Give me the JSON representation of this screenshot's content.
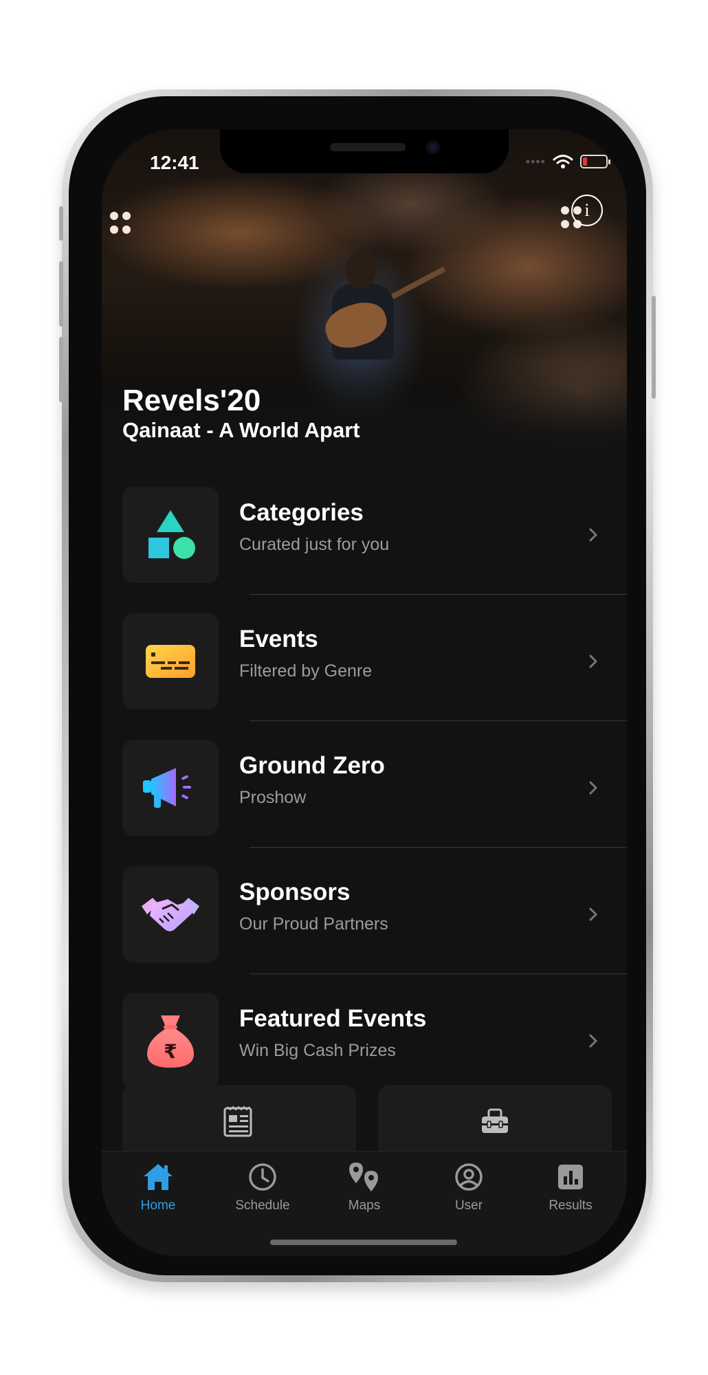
{
  "status_bar": {
    "time": "12:41"
  },
  "hero": {
    "title": "Revels'20",
    "subtitle": "Qainaat - A World Apart"
  },
  "menu": [
    {
      "title": "Categories",
      "subtitle": "Curated just for you",
      "icon": "shapes-icon"
    },
    {
      "title": "Events",
      "subtitle": "Filtered by Genre",
      "icon": "ticket-icon"
    },
    {
      "title": "Ground Zero",
      "subtitle": "Proshow",
      "icon": "megaphone-icon"
    },
    {
      "title": "Sponsors",
      "subtitle": "Our Proud Partners",
      "icon": "handshake-icon"
    },
    {
      "title": "Featured Events",
      "subtitle": "Win Big Cash Prizes",
      "icon": "money-bag-icon"
    }
  ],
  "cards": [
    {
      "icon": "newspaper-icon"
    },
    {
      "icon": "toolbox-icon"
    }
  ],
  "tabs": [
    {
      "label": "Home",
      "icon": "home-icon",
      "active": true
    },
    {
      "label": "Schedule",
      "icon": "clock-icon"
    },
    {
      "label": "Maps",
      "icon": "map-pins-icon"
    },
    {
      "label": "User",
      "icon": "user-circle-icon"
    },
    {
      "label": "Results",
      "icon": "bar-chart-icon"
    }
  ],
  "colors": {
    "accent": "#2f9ee6",
    "background": "#121212",
    "tile": "#1c1c1c",
    "battery_low": "#e53935"
  },
  "currency_symbol": "₹"
}
